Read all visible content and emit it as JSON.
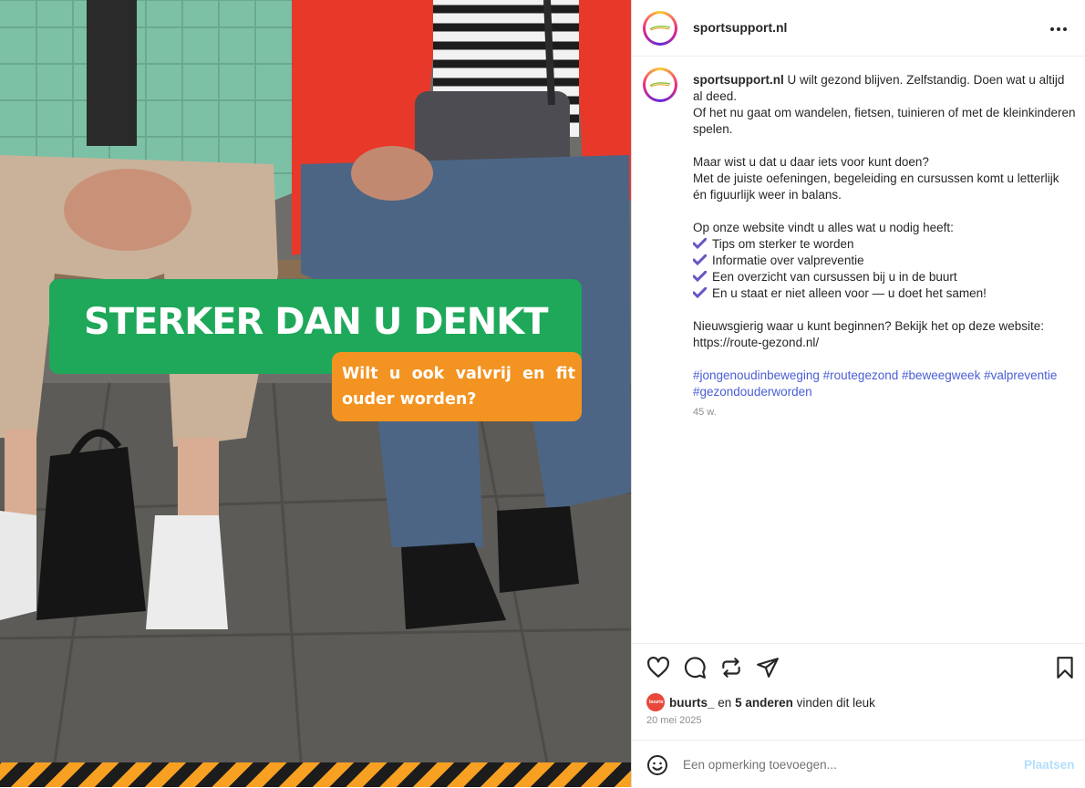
{
  "post": {
    "image": {
      "banner_title": "STERKER DAN U DENKT",
      "banner_subtitle": "Wilt u ook valvrij en fit ouder worden?",
      "colors": {
        "green": "#1fa85a",
        "orange": "#f39321",
        "hazard_stripe": "#f7a021"
      }
    },
    "header": {
      "username": "sportsupport.nl",
      "more_icon": "more-horizontal-icon"
    },
    "caption": {
      "username": "sportsupport.nl",
      "first_line": "U wilt gezond blijven. Zelfstandig. Doen wat u altijd al deed.",
      "line2": "Of het nu gaat om wandelen, fietsen, tuinieren of met de kleinkinderen spelen.",
      "para2_line1": "Maar wist u dat u daar iets voor kunt doen?",
      "para2_line2": "Met de juiste oefeningen, begeleiding en cursussen komt u letterlijk én figuurlijk weer in balans.",
      "para3_intro": "Op onze website vindt u alles wat u nodig heeft:",
      "bullets": [
        "Tips om sterker te worden",
        "Informatie over valpreventie",
        "Een overzicht van cursussen bij u in de buurt",
        "En u staat er niet alleen voor — u doet het samen!"
      ],
      "bullet_icon": "check-mark-icon",
      "para4_line1": "Nieuwsgierig waar u kunt beginnen? Bekijk het op deze website:",
      "para4_link": "https://route-gezond.nl/",
      "hashtags": [
        "#jongenoudinbeweging",
        "#routegezond",
        "#beweegweek",
        "#valpreventie",
        "#gezondouderworden"
      ],
      "age": "45 w."
    },
    "actions": {
      "icons": [
        "heart-icon",
        "comment-icon",
        "repost-icon",
        "share-icon",
        "bookmark-icon"
      ]
    },
    "likes": {
      "first_user": "buurts_",
      "conjunction": "en",
      "others": "5 anderen",
      "suffix": "vinden dit leuk",
      "mini_avatar_text": "buurts"
    },
    "date": "20 mei 2025",
    "comment": {
      "placeholder": "Een opmerking toevoegen...",
      "post_label": "Plaatsen",
      "emoji_icon": "emoji-icon"
    }
  }
}
